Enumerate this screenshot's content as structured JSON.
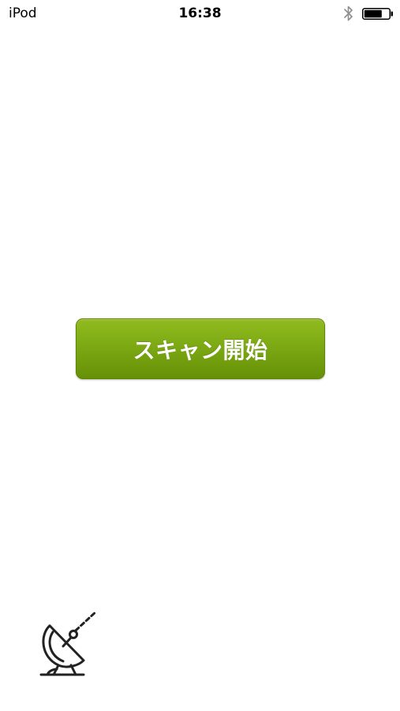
{
  "status_bar": {
    "carrier": "iPod",
    "time": "16:38",
    "icons": [
      "bluetooth-icon",
      "battery-icon"
    ]
  },
  "main": {
    "scan_button_label": "スキャン開始",
    "accent_color": "#7aa712"
  },
  "footer": {
    "icon": "satellite-dish-icon"
  }
}
